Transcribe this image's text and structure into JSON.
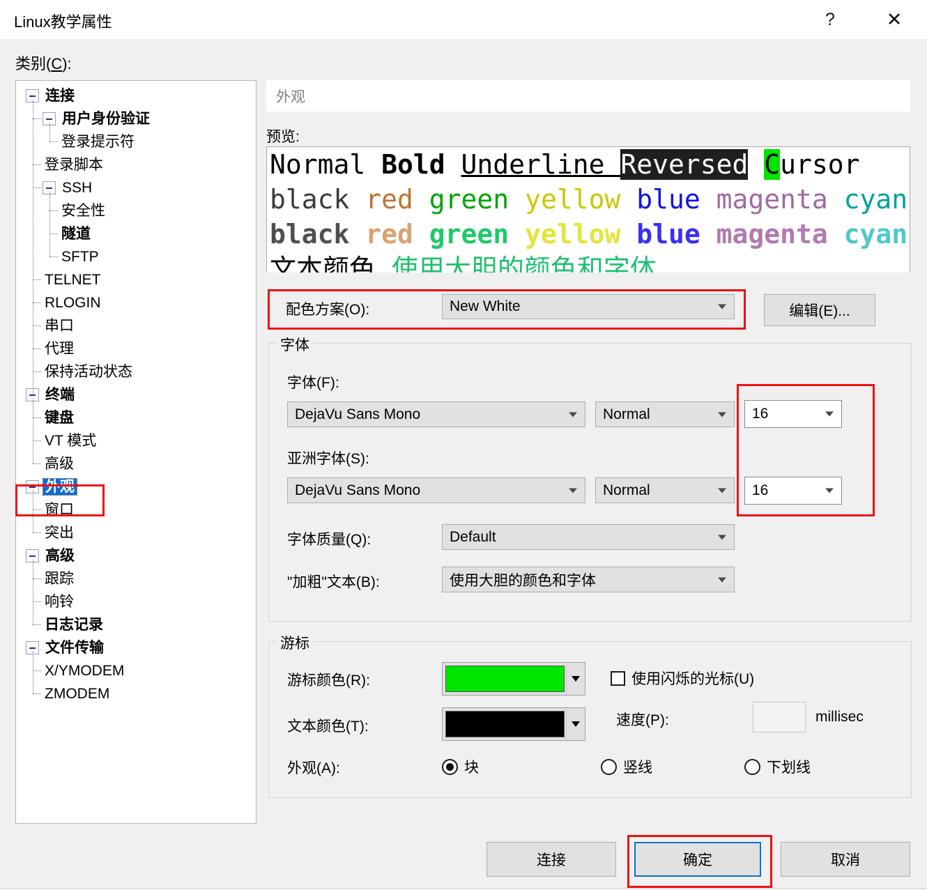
{
  "window": {
    "title": "Linux教学属性",
    "help_icon": "?",
    "close_icon": "✕"
  },
  "category": {
    "label": "类别(",
    "accel": "C",
    "label_end": "):"
  },
  "tree": {
    "items": [
      {
        "label": "连接",
        "depth": 0,
        "bold": true,
        "expander": true,
        "selected": false
      },
      {
        "label": "用户身份验证",
        "depth": 1,
        "bold": true,
        "expander": true,
        "selected": false
      },
      {
        "label": "登录提示符",
        "depth": 2,
        "bold": false,
        "expander": false,
        "selected": false
      },
      {
        "label": "登录脚本",
        "depth": 1,
        "bold": false,
        "expander": false,
        "selected": false
      },
      {
        "label": "SSH",
        "depth": 1,
        "bold": false,
        "expander": true,
        "selected": false
      },
      {
        "label": "安全性",
        "depth": 2,
        "bold": false,
        "expander": false,
        "selected": false
      },
      {
        "label": "隧道",
        "depth": 2,
        "bold": true,
        "expander": false,
        "selected": false
      },
      {
        "label": "SFTP",
        "depth": 2,
        "bold": false,
        "expander": false,
        "selected": false
      },
      {
        "label": "TELNET",
        "depth": 1,
        "bold": false,
        "expander": false,
        "selected": false
      },
      {
        "label": "RLOGIN",
        "depth": 1,
        "bold": false,
        "expander": false,
        "selected": false
      },
      {
        "label": "串口",
        "depth": 1,
        "bold": false,
        "expander": false,
        "selected": false
      },
      {
        "label": "代理",
        "depth": 1,
        "bold": false,
        "expander": false,
        "selected": false
      },
      {
        "label": "保持活动状态",
        "depth": 1,
        "bold": false,
        "expander": false,
        "selected": false
      },
      {
        "label": "终端",
        "depth": 0,
        "bold": true,
        "expander": true,
        "selected": false
      },
      {
        "label": "键盘",
        "depth": 1,
        "bold": true,
        "expander": false,
        "selected": false
      },
      {
        "label": "VT 模式",
        "depth": 1,
        "bold": false,
        "expander": false,
        "selected": false
      },
      {
        "label": "高级",
        "depth": 1,
        "bold": false,
        "expander": false,
        "selected": false
      },
      {
        "label": "外观",
        "depth": 0,
        "bold": true,
        "expander": true,
        "selected": true
      },
      {
        "label": "窗口",
        "depth": 1,
        "bold": false,
        "expander": false,
        "selected": false
      },
      {
        "label": "突出",
        "depth": 1,
        "bold": false,
        "expander": false,
        "selected": false
      },
      {
        "label": "高级",
        "depth": 0,
        "bold": true,
        "expander": true,
        "selected": false
      },
      {
        "label": "跟踪",
        "depth": 1,
        "bold": false,
        "expander": false,
        "selected": false
      },
      {
        "label": "响铃",
        "depth": 1,
        "bold": false,
        "expander": false,
        "selected": false
      },
      {
        "label": "日志记录",
        "depth": 1,
        "bold": true,
        "expander": false,
        "selected": false
      },
      {
        "label": "文件传输",
        "depth": 0,
        "bold": true,
        "expander": true,
        "selected": false
      },
      {
        "label": "X/YMODEM",
        "depth": 1,
        "bold": false,
        "expander": false,
        "selected": false
      },
      {
        "label": "ZMODEM",
        "depth": 1,
        "bold": false,
        "expander": false,
        "selected": false
      }
    ]
  },
  "pane": {
    "header": "外观",
    "preview_label": "预览:",
    "preview": {
      "line1": [
        {
          "text": "Normal ",
          "color": "#000000",
          "bold": false
        },
        {
          "text": "Bold ",
          "color": "#000000",
          "bold": true
        },
        {
          "text": "Underline ",
          "color": "#000000",
          "bold": false,
          "underline": true
        },
        {
          "text": "Reversed",
          "color": "#ffffff",
          "bg": "#1f1f1f",
          "bold": false
        },
        {
          "text": " ",
          "color": "#000000",
          "bold": false
        },
        {
          "text": "C",
          "color": "#000000",
          "bg": "#00e500",
          "bold": false
        },
        {
          "text": "ursor",
          "color": "#000000",
          "bold": false
        }
      ],
      "line2": [
        {
          "text": "black ",
          "color": "#3b3b3b"
        },
        {
          "text": "red ",
          "color": "#bf7330"
        },
        {
          "text": "green ",
          "color": "#00a400"
        },
        {
          "text": "yellow ",
          "color": "#c8c800"
        },
        {
          "text": "blue ",
          "color": "#1212e0"
        },
        {
          "text": "magenta ",
          "color": "#a06aa0"
        },
        {
          "text": "cyan",
          "color": "#00a0a0"
        }
      ],
      "line3": [
        {
          "text": "black ",
          "color": "#4f4f4f"
        },
        {
          "text": "red ",
          "color": "#d9a273"
        },
        {
          "text": "green ",
          "color": "#1fc96a"
        },
        {
          "text": "yellow ",
          "color": "#e4e43c"
        },
        {
          "text": "blue ",
          "color": "#3a2ff0"
        },
        {
          "text": "magenta ",
          "color": "#b07bb0"
        },
        {
          "text": "cyan",
          "color": "#4fc8c8"
        }
      ],
      "line4": [
        {
          "text": "文本颜色 ",
          "color": "#000000"
        },
        {
          "text": "使用大胆的颜色和字体",
          "color": "#20c070"
        }
      ]
    },
    "scheme": {
      "label": "配色方案(O):",
      "value": "New White",
      "edit_button": "编辑(E)..."
    },
    "font_group": {
      "title": "字体",
      "font_label": "字体(F):",
      "font_value": "DejaVu Sans Mono",
      "font_style": "Normal",
      "font_size": "16",
      "asian_label": "亚洲字体(S):",
      "asian_value": "DejaVu Sans Mono",
      "asian_style": "Normal",
      "asian_size": "16",
      "quality_label": "字体质量(Q):",
      "quality_value": "Default",
      "bold_label": "\"加粗\"文本(B):",
      "bold_value": "使用大胆的颜色和字体"
    },
    "cursor_group": {
      "title": "游标",
      "cursor_color_label": "游标颜色(R):",
      "cursor_color": "#00e500",
      "text_color_label": "文本颜色(T):",
      "text_color": "#000000",
      "blink_label": "使用闪烁的光标(U)",
      "blink_checked": false,
      "speed_label": "速度(P):",
      "speed_value": "",
      "speed_unit": "millisec",
      "appearance_label": "外观(A):",
      "options": [
        {
          "label": "块",
          "selected": true
        },
        {
          "label": "竖线",
          "selected": false
        },
        {
          "label": "下划线",
          "selected": false
        }
      ]
    }
  },
  "footer": {
    "connect": "连接",
    "ok": "确定",
    "cancel": "取消"
  },
  "annotation_color": "#ee1111"
}
